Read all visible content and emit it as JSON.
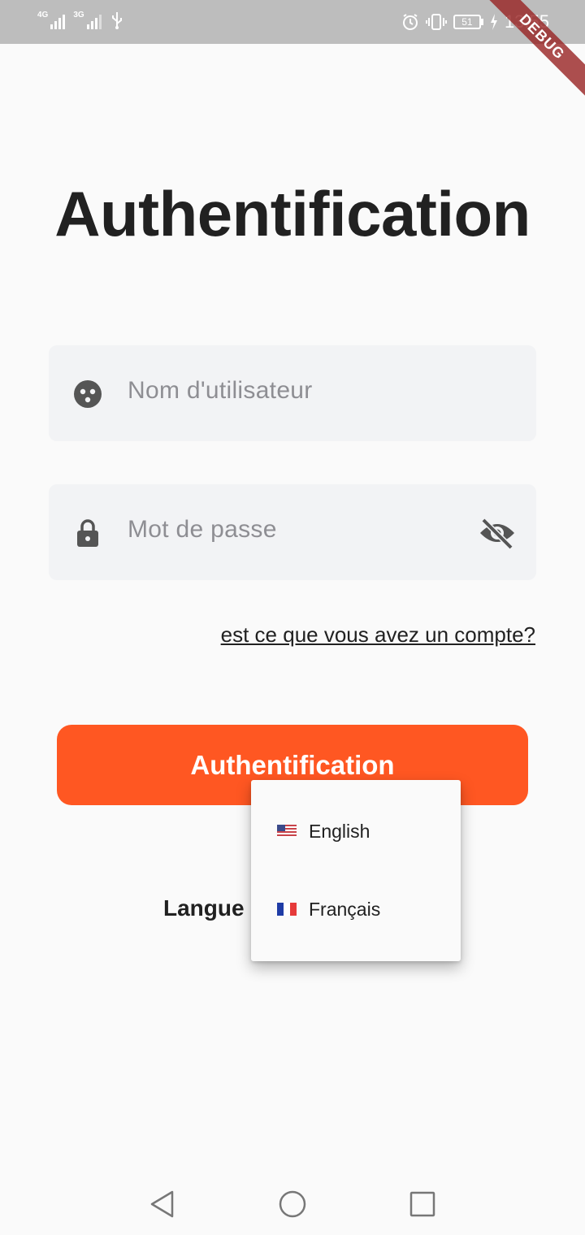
{
  "status_bar": {
    "network_1": "4G",
    "network_2": "3G",
    "battery_level": "51",
    "time": "13:55"
  },
  "debug_banner": "DEBUG",
  "title": "Authentification",
  "form": {
    "username_placeholder": "Nom d'utilisateur",
    "password_placeholder": "Mot de passe",
    "account_link": "est ce que vous avez un compte?",
    "submit_label": "Authentification"
  },
  "language": {
    "label": "Langue",
    "options": [
      {
        "label": "English",
        "flag": "us-flag-icon"
      },
      {
        "label": "Français",
        "flag": "fr-flag-icon"
      }
    ]
  },
  "colors": {
    "primary": "#ff5722",
    "field_bg": "#f2f3f5",
    "status_bar": "#bdbdbd",
    "debug_ribbon": "#9a1e1e"
  },
  "icons": {
    "username_field": "face-icon",
    "password_field": "lock-icon",
    "password_toggle": "eye-off-icon",
    "nav": [
      "back-triangle-icon",
      "home-circle-icon",
      "recents-square-icon"
    ]
  }
}
